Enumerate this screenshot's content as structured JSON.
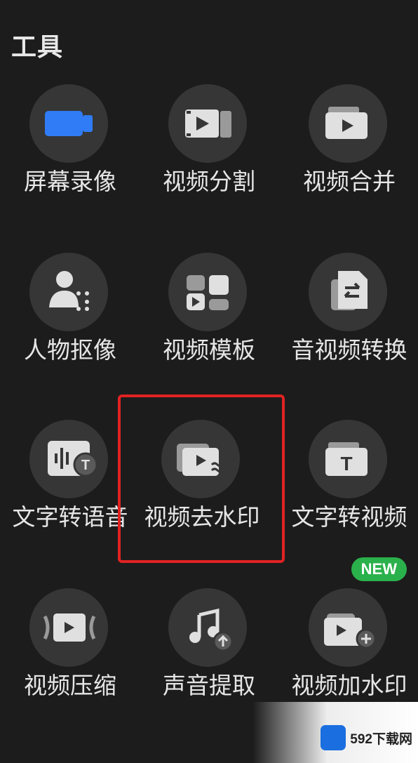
{
  "section_title": "工具",
  "tools": [
    {
      "label": "屏幕录像",
      "icon": "screen-record-icon"
    },
    {
      "label": "视频分割",
      "icon": "video-split-icon"
    },
    {
      "label": "视频合并",
      "icon": "video-merge-icon"
    },
    {
      "label": "人物抠像",
      "icon": "person-cutout-icon"
    },
    {
      "label": "视频模板",
      "icon": "video-template-icon"
    },
    {
      "label": "音视频转换",
      "icon": "av-convert-icon"
    },
    {
      "label": "文字转语音",
      "icon": "text-to-speech-icon"
    },
    {
      "label": "视频去水印",
      "icon": "remove-watermark-icon"
    },
    {
      "label": "文字转视频",
      "icon": "text-to-video-icon"
    },
    {
      "label": "视频压缩",
      "icon": "video-compress-icon"
    },
    {
      "label": "声音提取",
      "icon": "audio-extract-icon"
    },
    {
      "label": "视频加水印",
      "icon": "add-watermark-icon"
    }
  ],
  "new_badge": "NEW",
  "watermark_text": "592下载网",
  "colors": {
    "accent_blue": "#2f7cf6",
    "badge_green": "#2bb14b",
    "highlight_red": "#e12222"
  }
}
